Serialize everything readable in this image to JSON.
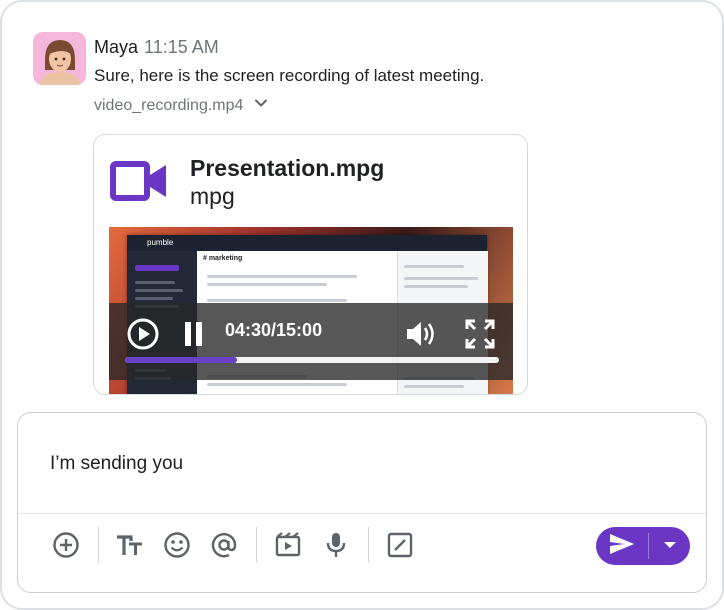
{
  "message": {
    "sender_name": "Maya",
    "time": "11:15 AM",
    "text": "Sure, here is the screen recording of latest meeting.",
    "attachment_name": "video_recording.mp4"
  },
  "card": {
    "title": "Presentation.mpg",
    "type": "mpg",
    "video": {
      "current_time": "04:30/15:00",
      "progress_fraction": 0.3,
      "preview_app_name": "pumble",
      "preview_channel": "# marketing"
    }
  },
  "composer": {
    "text": "I’m sending you"
  },
  "colors": {
    "accent": "#6b36c4",
    "video_icon": "#6b36c4",
    "icon_gray": "#5f6368"
  },
  "icons": {
    "toolbar": [
      "add-circle-icon",
      "text-format-icon",
      "emoji-icon",
      "mention-icon",
      "video-clip-icon",
      "microphone-icon",
      "slash-command-icon"
    ],
    "send": "send-icon",
    "send_options": "caret-down-icon"
  }
}
